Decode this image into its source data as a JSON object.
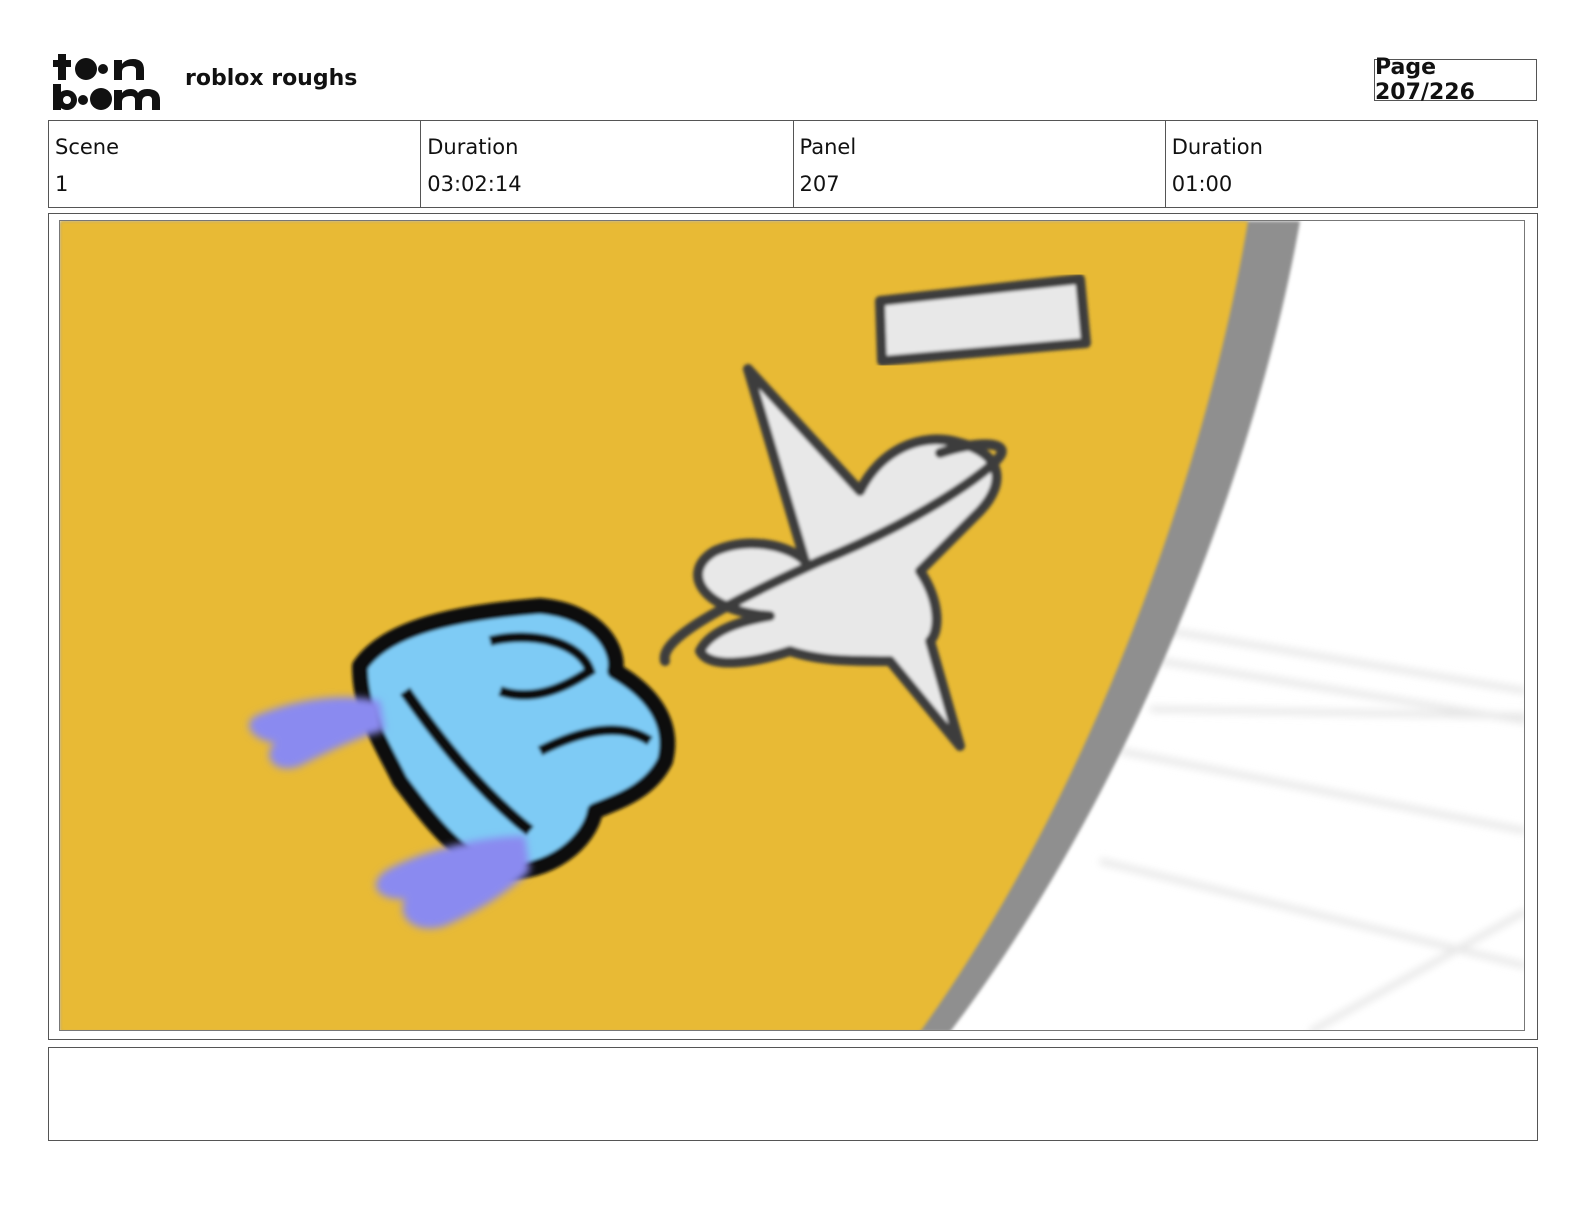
{
  "header": {
    "logo_text": "toon boom",
    "project_title": "roblox roughs",
    "page_label": "Page 207/226"
  },
  "info_table": [
    {
      "label": "Scene",
      "value": "1"
    },
    {
      "label": "Duration",
      "value": "03:02:14"
    },
    {
      "label": "Panel",
      "value": "207"
    },
    {
      "label": "Duration",
      "value": "01:00"
    }
  ],
  "panel": {
    "background_color": "#E8BA35",
    "edge_color": "#8F8F8F",
    "character_color": "#7ECBF5",
    "character_outline": "#111111",
    "flame_color": "#8A8AF0",
    "plane_color": "#E8E8E8",
    "plane_outline": "#3C3C3C"
  },
  "notes": {
    "text": ""
  }
}
